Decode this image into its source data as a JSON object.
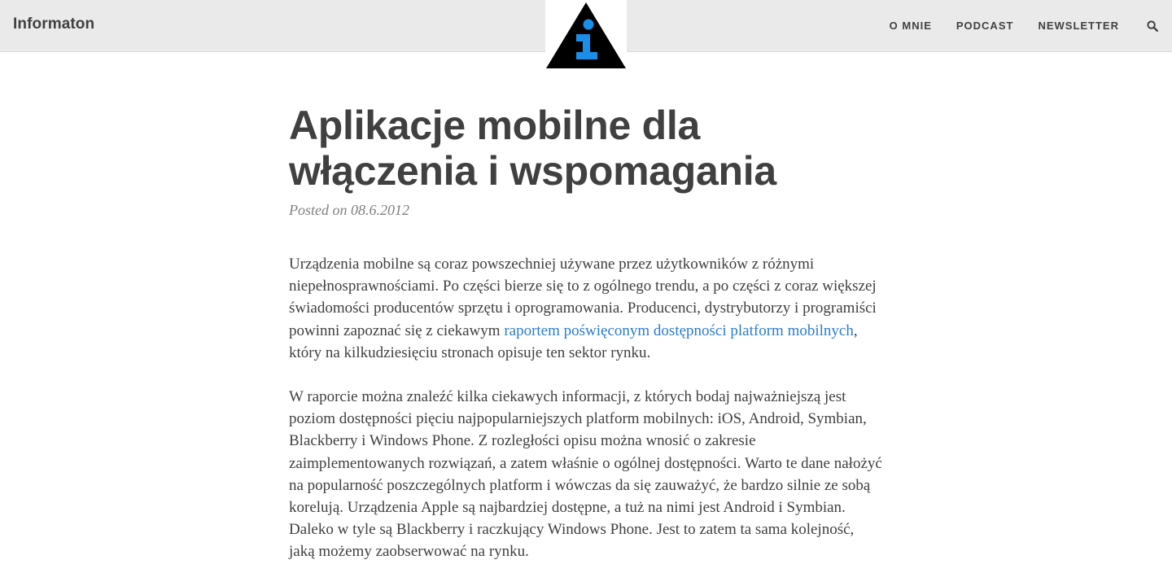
{
  "nav": {
    "brand": "Informaton",
    "links": [
      "O MNIE",
      "PODCAST",
      "NEWSLETTER"
    ],
    "search_icon": "search-icon",
    "logo_icon": "info-triangle-logo"
  },
  "post": {
    "title": "Aplikacje mobilne dla włączenia i wspomagania",
    "meta": "Posted on 08.6.2012",
    "p1": {
      "before": "Urządzenia mobilne są coraz powszechniej używane przez użytkowników z różnymi niepełnosprawnościami. Po części bierze się to z ogólnego trendu, a po części z coraz większej świadomości producentów sprzętu i oprogramowania. Producenci, dystrybutorzy i programiści powinni zapoznać się z ciekawym ",
      "link": "raportem poświęconym dostępności platform mobilnych",
      "after": ", który na kilkudziesięciu stronach opisuje ten sektor rynku."
    },
    "p2": "W raporcie można znaleźć kilka ciekawych informacji, z których bodaj najważniejszą jest poziom dostępności pięciu najpopularniejszych platform mobilnych: iOS, Android, Symbian, Blackberry i Windows Phone. Z rozległości opisu można wnosić o zakresie zaimplementowanych rozwiązań, a zatem właśnie o ogólnej dostępności. Warto te dane nałożyć na popularność poszczególnych platform i wówczas da się zauważyć, że bardzo silnie ze sobą korelują. Urządzenia Apple są najbardziej dostępne, a tuż na nimi jest Android i Symbian. Daleko w tyle są Blackberry i raczkujący Windows Phone. Jest to zatem ta sama kolejność, jaką możemy zaobserwować na rynku."
  },
  "colors": {
    "navbar_bg": "#eaeaea",
    "text": "#404040",
    "link": "#2a7bd1",
    "logo_blue": "#1a8fe8"
  }
}
